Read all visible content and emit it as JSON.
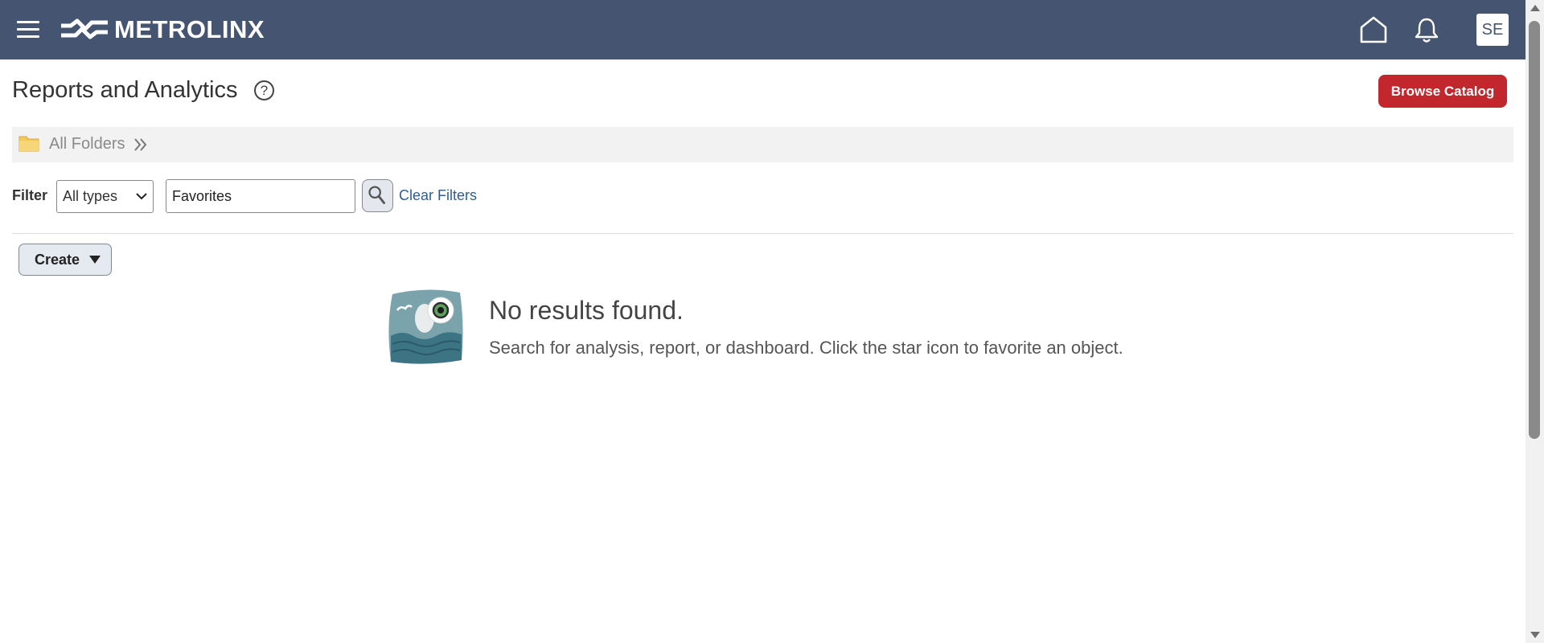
{
  "header": {
    "brand": "METROLINX",
    "avatar_initials": "SE",
    "icons": [
      "menu-icon",
      "home-icon",
      "bell-icon"
    ],
    "background_color": "#455571"
  },
  "page": {
    "title": "Reports and Analytics",
    "help_glyph": "?",
    "browse_catalog_label": "Browse Catalog",
    "accent_color": "#c1272d"
  },
  "breadcrumb": {
    "root_label": "All Folders"
  },
  "filter": {
    "label": "Filter",
    "type_selected": "All types",
    "search_value": "Favorites",
    "clear_label": "Clear Filters"
  },
  "toolbar": {
    "create_label": "Create"
  },
  "empty_state": {
    "title": "No results found.",
    "description": "Search for analysis, report, or dashboard. Click the star icon to favorite an object."
  }
}
